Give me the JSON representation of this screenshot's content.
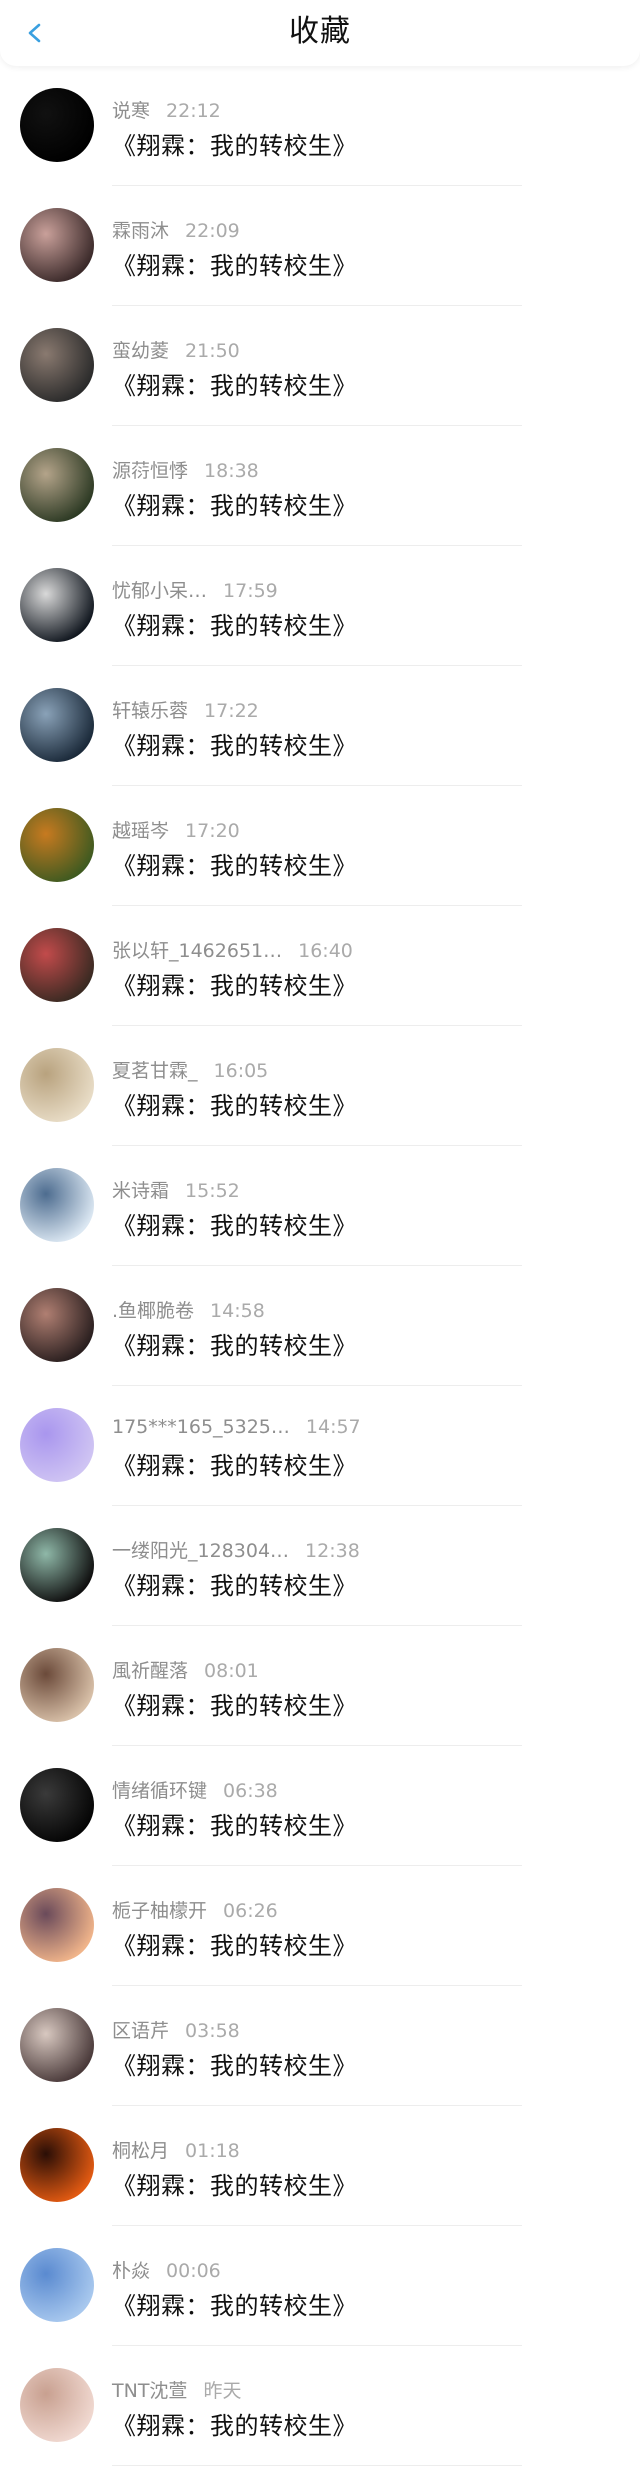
{
  "header": {
    "title": "收藏",
    "back_icon": "chevron-left-icon",
    "accent_color": "#3aa0e0"
  },
  "items": [
    {
      "name": "说寒",
      "time": "22:12",
      "content": "《翔霖：我的转校生》",
      "avatar_colors": [
        "#000000",
        "#111111"
      ]
    },
    {
      "name": "霖雨沐",
      "time": "22:09",
      "content": "《翔霖：我的转校生》",
      "avatar_colors": [
        "#3b2a2a",
        "#c9a09a"
      ]
    },
    {
      "name": "蛮幼菱",
      "time": "21:50",
      "content": "《翔霖：我的转校生》",
      "avatar_colors": [
        "#2b2b2b",
        "#8a7a70"
      ]
    },
    {
      "name": "源葕恒悸",
      "time": "18:38",
      "content": "《翔霖：我的转校生》",
      "avatar_colors": [
        "#2d3a24",
        "#b4a48a"
      ]
    },
    {
      "name": "忧郁小呆…",
      "time": "17:59",
      "content": "《翔霖：我的转校生》",
      "avatar_colors": [
        "#121820",
        "#d9d9d9"
      ]
    },
    {
      "name": "轩辕乐蓉",
      "time": "17:22",
      "content": "《翔霖：我的转校生》",
      "avatar_colors": [
        "#1b2a3a",
        "#8aa2b8"
      ]
    },
    {
      "name": "越瑶岑",
      "time": "17:20",
      "content": "《翔霖：我的转校生》",
      "avatar_colors": [
        "#3f5a20",
        "#c77a20"
      ]
    },
    {
      "name": "张以轩_1462651…",
      "time": "16:40",
      "content": "《翔霖：我的转校生》",
      "avatar_colors": [
        "#3a2a22",
        "#c24b4b"
      ]
    },
    {
      "name": "夏茗甘霖_",
      "time": "16:05",
      "content": "《翔霖：我的转校生》",
      "avatar_colors": [
        "#e8dcc6",
        "#b8a27e"
      ]
    },
    {
      "name": "米诗霜",
      "time": "15:52",
      "content": "《翔霖：我的转校生》",
      "avatar_colors": [
        "#dbe7f2",
        "#4d6c8f"
      ]
    },
    {
      "name": ".鱼椰脆卷",
      "time": "14:58",
      "content": "《翔霖：我的转校生》",
      "avatar_colors": [
        "#2a1f1f",
        "#b07f72"
      ]
    },
    {
      "name": "175***165_5325…",
      "time": "14:57",
      "content": "《翔霖：我的转校生》",
      "avatar_colors": [
        "#cfc4f3",
        "#a996ee"
      ]
    },
    {
      "name": "一缕阳光_128304…",
      "time": "12:38",
      "content": "《翔霖：我的转校生》",
      "avatar_colors": [
        "#101010",
        "#8fb8a8"
      ]
    },
    {
      "name": "風祈醒落",
      "time": "08:01",
      "content": "《翔霖：我的转校生》",
      "avatar_colors": [
        "#d8c0a8",
        "#6b4a3a"
      ]
    },
    {
      "name": "情绪循环键",
      "time": "06:38",
      "content": "《翔霖：我的转校生》",
      "avatar_colors": [
        "#050505",
        "#3a3a3a"
      ]
    },
    {
      "name": "栀子柚檬开",
      "time": "06:26",
      "content": "《翔霖：我的转校生》",
      "avatar_colors": [
        "#f0b48a",
        "#6a4a5a"
      ]
    },
    {
      "name": "区语芹",
      "time": "03:58",
      "content": "《翔霖：我的转校生》",
      "avatar_colors": [
        "#4a3a3a",
        "#d8c8c0"
      ]
    },
    {
      "name": "桐松月",
      "time": "01:18",
      "content": "《翔霖：我的转校生》",
      "avatar_colors": [
        "#e25a12",
        "#2a0e06"
      ]
    },
    {
      "name": "朴焱",
      "time": "00:06",
      "content": "《翔霖：我的转校生》",
      "avatar_colors": [
        "#a8c8ee",
        "#5a8ad0"
      ]
    },
    {
      "name": "TNT沈萱",
      "time": "昨天",
      "content": "《翔霖：我的转校生》",
      "avatar_colors": [
        "#f0d8d0",
        "#c8a090"
      ]
    }
  ]
}
